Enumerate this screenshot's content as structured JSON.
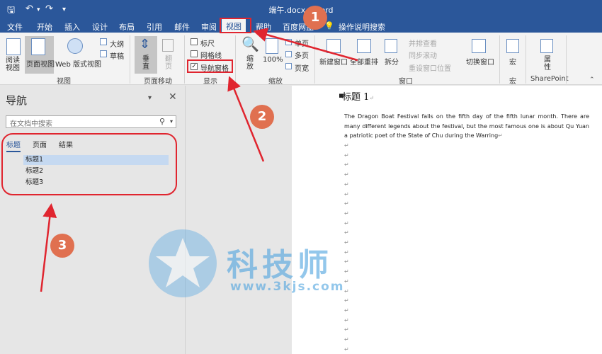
{
  "window": {
    "title": "端午.docx - Word"
  },
  "tabs": [
    "文件",
    "开始",
    "插入",
    "设计",
    "布局",
    "引用",
    "邮件",
    "审阅",
    "视图",
    "帮助",
    "百度网盘",
    "操作说明搜索"
  ],
  "active_tab": "视图",
  "ribbon": {
    "views": {
      "read_mode": "阅读\n视图",
      "print_layout": "页面视图",
      "web_layout": "Web 版式视图",
      "outline": "大纲",
      "draft": "草稿",
      "group": "视图"
    },
    "page_movement": {
      "vertical": "垂\n直",
      "side": "翻\n页",
      "group": "页面移动"
    },
    "show": {
      "ruler": "标尺",
      "gridlines": "网格线",
      "nav_pane": "导航窗格",
      "group": "显示",
      "ruler_checked": false,
      "gridlines_checked": false,
      "nav_checked": true
    },
    "zoom": {
      "zoom": "缩\n放",
      "hundred": "100%",
      "one_page": "单页",
      "multi_page": "多页",
      "page_width": "页宽",
      "group": "缩放"
    },
    "window": {
      "new_window": "新建窗口",
      "arrange_all": "全部重排",
      "split": "拆分",
      "side_by_side": "并排查看",
      "sync_scroll": "同步滚动",
      "reset_pos": "重设窗口位置",
      "switch": "切换窗口",
      "group": "窗口"
    },
    "macros": {
      "label": "宏",
      "group": "宏"
    },
    "sharepoint": {
      "label": "属\n性",
      "group": "SharePoint"
    }
  },
  "nav": {
    "title": "导航",
    "search_placeholder": "在文档中搜索",
    "tabs": [
      "标题",
      "页面",
      "结果"
    ],
    "headings": [
      "标题1",
      "标题2",
      "标题3"
    ]
  },
  "document": {
    "heading": "标题 1",
    "paragraph": "The Dragon Boat Festival falls on the fifth day of the fifth lunar month. There are many different legends about the festival, but the most famous one is about Qu Yuan a patriotic poet of the State of Chu during the Warring"
  },
  "annotations": {
    "c1": "1",
    "c2": "2",
    "c3": "3"
  },
  "watermark": {
    "text": "科技师",
    "url": "www.3kjs.com"
  },
  "colors": {
    "word_blue": "#2b579a",
    "annotation_red": "#e0252f",
    "circle": "#e07050"
  }
}
